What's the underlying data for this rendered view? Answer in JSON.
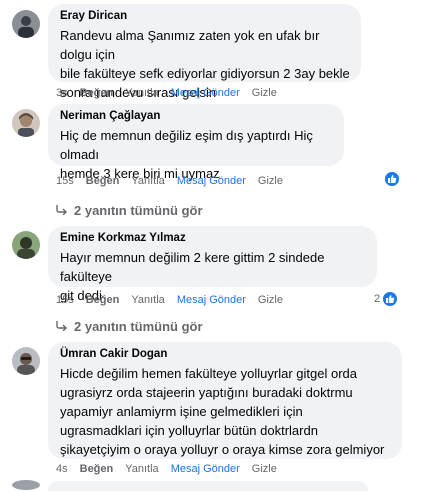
{
  "comments": [
    {
      "author": "Eray Dirican",
      "text": "Randevu alma Şanımız zaten yok en ufak bır dolgu için\nbile fakülteye sefk ediyorlar gidiyorsun 2 3ay bekle\nsonra randevu sırası gelsin",
      "time": "3s",
      "like": "Beğen",
      "reply": "Yanıtla",
      "message": "Mesaj Gönder",
      "hide": "Gizle"
    },
    {
      "author": "Neriman Çağlayan",
      "text": "Hiç de memnun değiliz eşim dış yaptırdı Hiç olmadı\nhemde 3 kere biri mi uymaz",
      "time": "15s",
      "like": "Beğen",
      "reply": "Yanıtla",
      "message": "Mesaj Gönder",
      "hide": "Gizle",
      "replies_link": "2 yanıtın tümünü gör"
    },
    {
      "author": "Emine Korkmaz Yılmaz",
      "text": "Hayır memnun değilim 2 kere gittim 2 sindede fakülteye\ngit dedi",
      "time": "15s",
      "like": "Beğen",
      "reply": "Yanıtla",
      "message": "Mesaj Gönder",
      "hide": "Gizle",
      "reaction_count": "2",
      "replies_link": "2 yanıtın tümünü gör"
    },
    {
      "author": "Ümran Cakir Dogan",
      "text": "Hicde değilim hemen fakülteye yolluyrlar gitgel orda\nugrasiyrz orda stajeerin yaptığını buradaki doktrmu\nyapamiyr anlamiyrm işine gelmedikleri için\nugrasmadklari için yolluyrlar bütün doktrlardn\nşikayetçiyim o oraya yolluyr o oraya kimse zora gelmiyor",
      "time": "4s",
      "like": "Beğen",
      "reply": "Yanıtla",
      "message": "Mesaj Gönder",
      "hide": "Gizle"
    }
  ],
  "colors": {
    "bubble": "#f0f2f5",
    "accent": "#1b74e4",
    "secondary_text": "#65676b"
  }
}
